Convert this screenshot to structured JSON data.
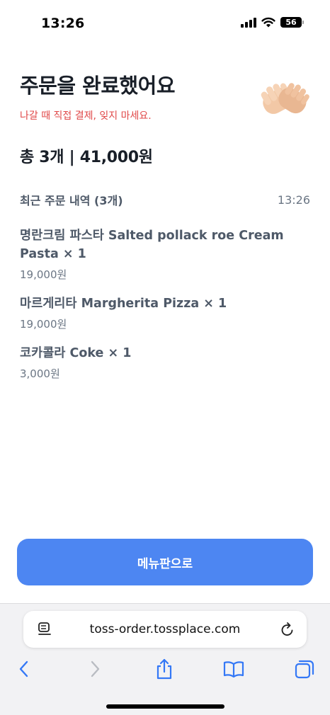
{
  "status_bar": {
    "time": "13:26",
    "battery_level": "56"
  },
  "header": {
    "title": "주문을 완료했어요",
    "subtitle": "나갈 때 직접 결제, 잊지 마세요.",
    "emoji_icon": "clapping-hands-icon"
  },
  "summary": {
    "total": "총 3개 | 41,000원"
  },
  "history": {
    "title": "최근 주문 내역 (3개)",
    "time": "13:26",
    "items": [
      {
        "name": "명란크림 파스타 Salted pollack roe Cream Pasta × 1",
        "price": "19,000원"
      },
      {
        "name": "마르게리타 Margherita Pizza × 1",
        "price": "19,000원"
      },
      {
        "name": "코카콜라 Coke × 1",
        "price": "3,000원"
      }
    ]
  },
  "actions": {
    "menu_button": "메뉴판으로"
  },
  "browser": {
    "url": "toss-order.tossplace.com",
    "toolbar_icons": [
      "back-icon",
      "forward-icon",
      "share-icon",
      "bookmarks-icon",
      "tabs-icon"
    ]
  },
  "colors": {
    "accent": "#4d86f2",
    "warning_text": "#e04848",
    "title_text": "#191f28"
  }
}
